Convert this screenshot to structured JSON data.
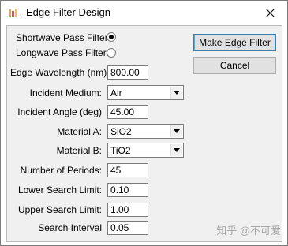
{
  "window": {
    "title": "Edge Filter Design"
  },
  "filter_type": {
    "shortwave_label": "Shortwave Pass Filter:",
    "longwave_label": "Longwave Pass Filter:",
    "selected": "shortwave"
  },
  "fields": {
    "edge_wavelength": {
      "label": "Edge Wavelength (nm)",
      "value": "800.00"
    },
    "incident_medium": {
      "label": "Incident Medium:",
      "value": "Air"
    },
    "incident_angle": {
      "label": "Incident Angle (deg)",
      "value": "45.00"
    },
    "material_a": {
      "label": "Material A:",
      "value": "SiO2"
    },
    "material_b": {
      "label": "Material B:",
      "value": "TiO2"
    },
    "num_periods": {
      "label": "Number of Periods:",
      "value": "45"
    },
    "lower_search": {
      "label": "Lower Search Limit:",
      "value": "0.10"
    },
    "upper_search": {
      "label": "Upper Search Limit:",
      "value": "1.00"
    },
    "search_interval": {
      "label": "Search Interval",
      "value": "0.05"
    }
  },
  "buttons": {
    "make": "Make Edge Filter",
    "cancel": "Cancel"
  },
  "watermark": "知乎 @不可爱",
  "icons": {
    "app": "app-icon",
    "close": "close-icon",
    "dropdown": "chevron-down-icon"
  },
  "colors": {
    "dialog_bg": "#f0f0f0",
    "titlebar_bg": "#ffffff",
    "default_button_border": "#3c7fb1"
  }
}
